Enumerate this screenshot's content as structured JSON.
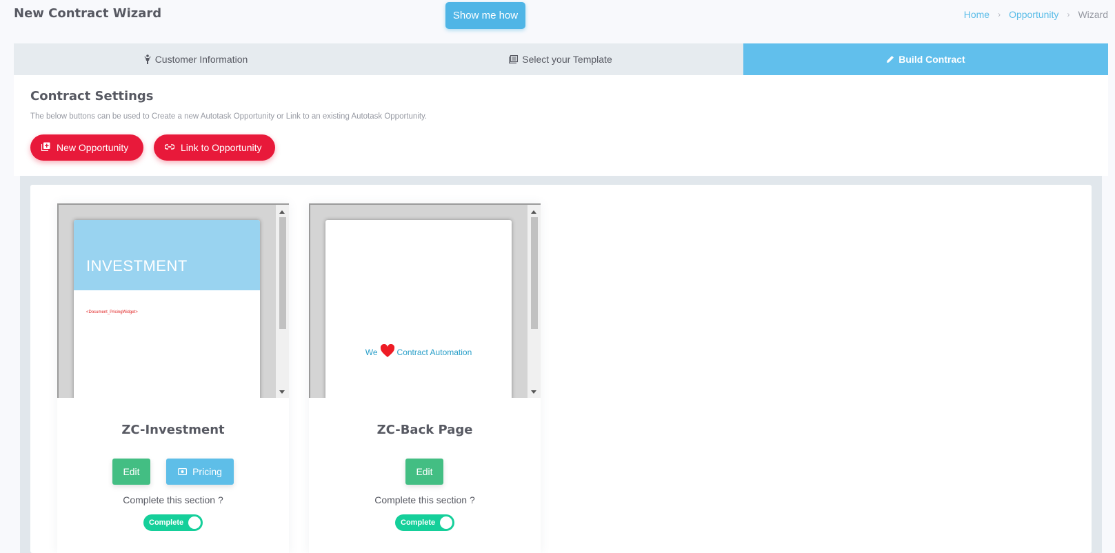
{
  "header": {
    "title": "New Contract Wizard",
    "help_button": "Show me how",
    "breadcrumb": [
      "Home",
      "Opportunity",
      "Wizard"
    ]
  },
  "steps": [
    {
      "label": "Customer Information",
      "icon": "person-icon",
      "active": false
    },
    {
      "label": "Select your Template",
      "icon": "template-icon",
      "active": false
    },
    {
      "label": "Build Contract",
      "icon": "pencil-icon",
      "active": true
    }
  ],
  "settings": {
    "title": "Contract Settings",
    "description": "The below buttons can be used to Create a new Autotask Opportunity or Link to an existing Autotask Opportunity.",
    "new_opportunity": "New Opportunity",
    "link_opportunity": "Link to Opportunity"
  },
  "cards": [
    {
      "name": "ZC-Investment",
      "preview_banner": "INVESTMENT",
      "preview_tag": "<Document_PricingWidget>",
      "edit_label": "Edit",
      "pricing_label": "Pricing",
      "complete_question": "Complete this section ?",
      "toggle_label": "Complete",
      "complete": true
    },
    {
      "name": "ZC-Back Page",
      "preview_text_before": "We",
      "preview_text_after": "Contract Automation",
      "edit_label": "Edit",
      "complete_question": "Complete this section ?",
      "toggle_label": "Complete",
      "complete": true
    }
  ],
  "colors": {
    "accent_blue": "#61bfec",
    "danger_red": "#e8193a",
    "success_green": "#43be83",
    "toggle_green": "#15cf9a"
  }
}
